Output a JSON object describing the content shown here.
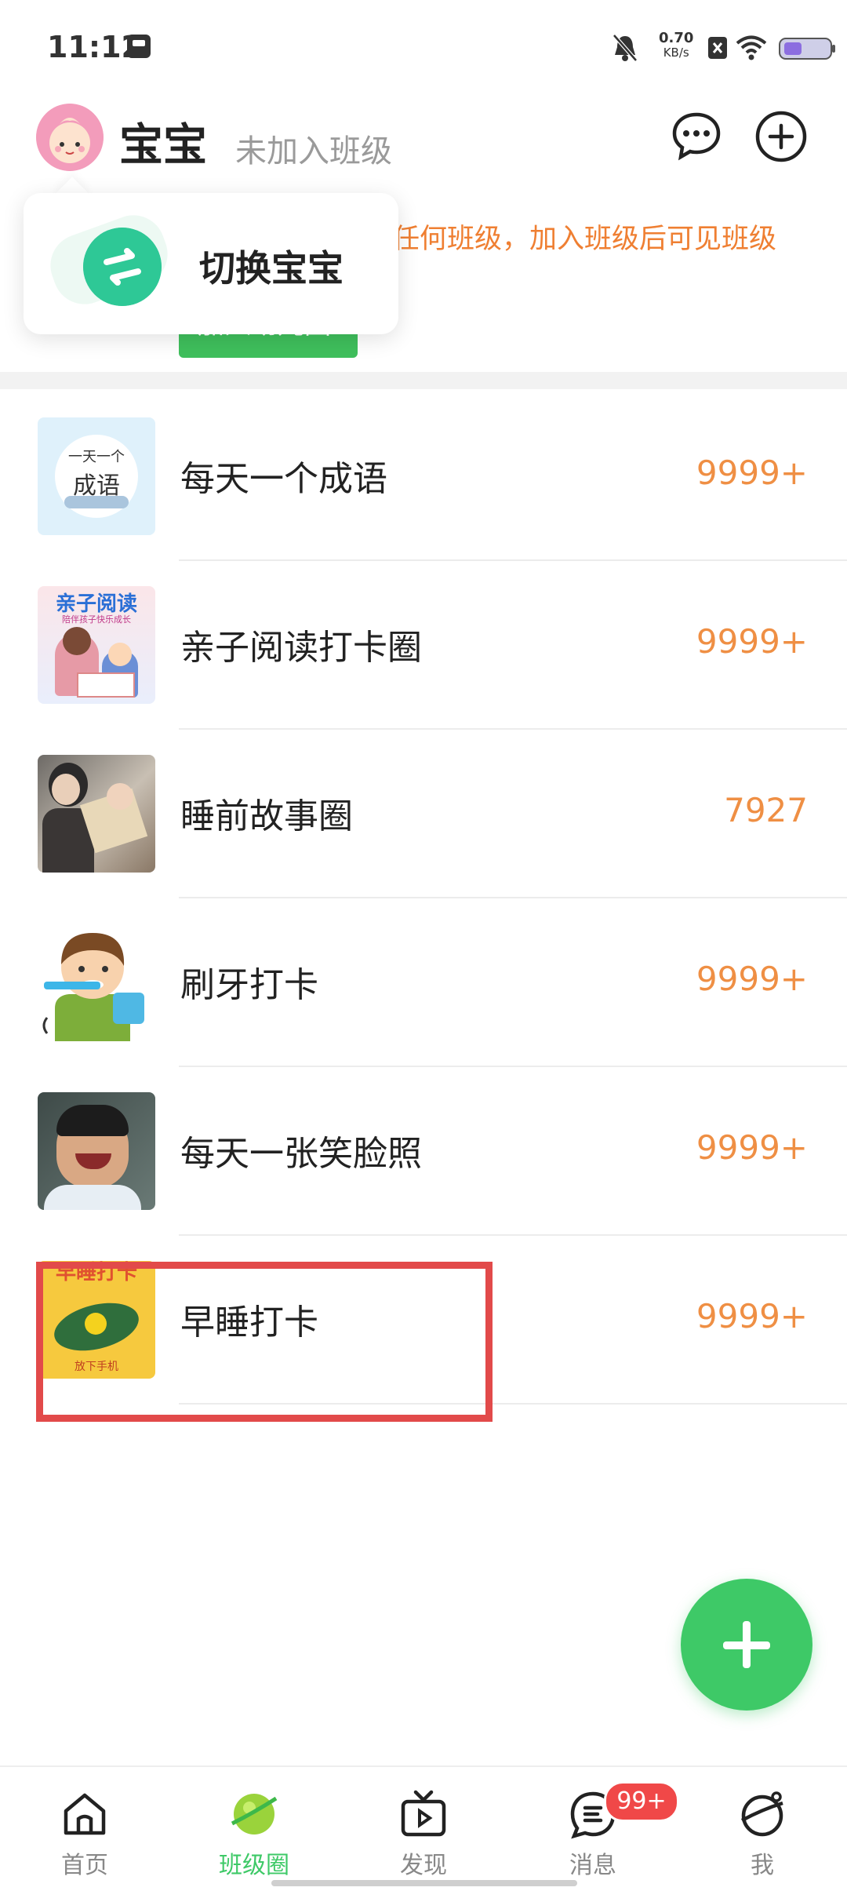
{
  "status_bar": {
    "time": "11:12",
    "net_speed_value": "0.70",
    "net_speed_unit": "KB/s"
  },
  "header": {
    "baby_name": "宝宝",
    "class_status": "未加入班级"
  },
  "popup": {
    "label": "切换宝宝"
  },
  "notice": {
    "text": "任何班级，加入班级后可见班级",
    "join_button": "加入幼儿园"
  },
  "list": [
    {
      "title": "每天一个成语",
      "count": "9999+",
      "thumb_text": "一天一个",
      "thumb_text2": "成语"
    },
    {
      "title": "亲子阅读打卡圈",
      "count": "9999+",
      "thumb_text": "亲子阅读",
      "thumb_text2": "陪伴孩子快乐成长"
    },
    {
      "title": "睡前故事圈",
      "count": "7927"
    },
    {
      "title": "刷牙打卡",
      "count": "9999+"
    },
    {
      "title": "每天一张笑脸照",
      "count": "9999+"
    },
    {
      "title": "早睡打卡",
      "count": "9999+",
      "thumb_text": "早睡打卡",
      "thumb_text2": "放下手机"
    }
  ],
  "nav": {
    "items": [
      {
        "label": "首页"
      },
      {
        "label": "班级圈"
      },
      {
        "label": "发现"
      },
      {
        "label": "消息"
      },
      {
        "label": "我"
      }
    ],
    "message_badge": "99+"
  },
  "colors": {
    "accent_green": "#3ec967",
    "count_orange": "#ef8f44",
    "highlight_red": "#e24a4a"
  }
}
